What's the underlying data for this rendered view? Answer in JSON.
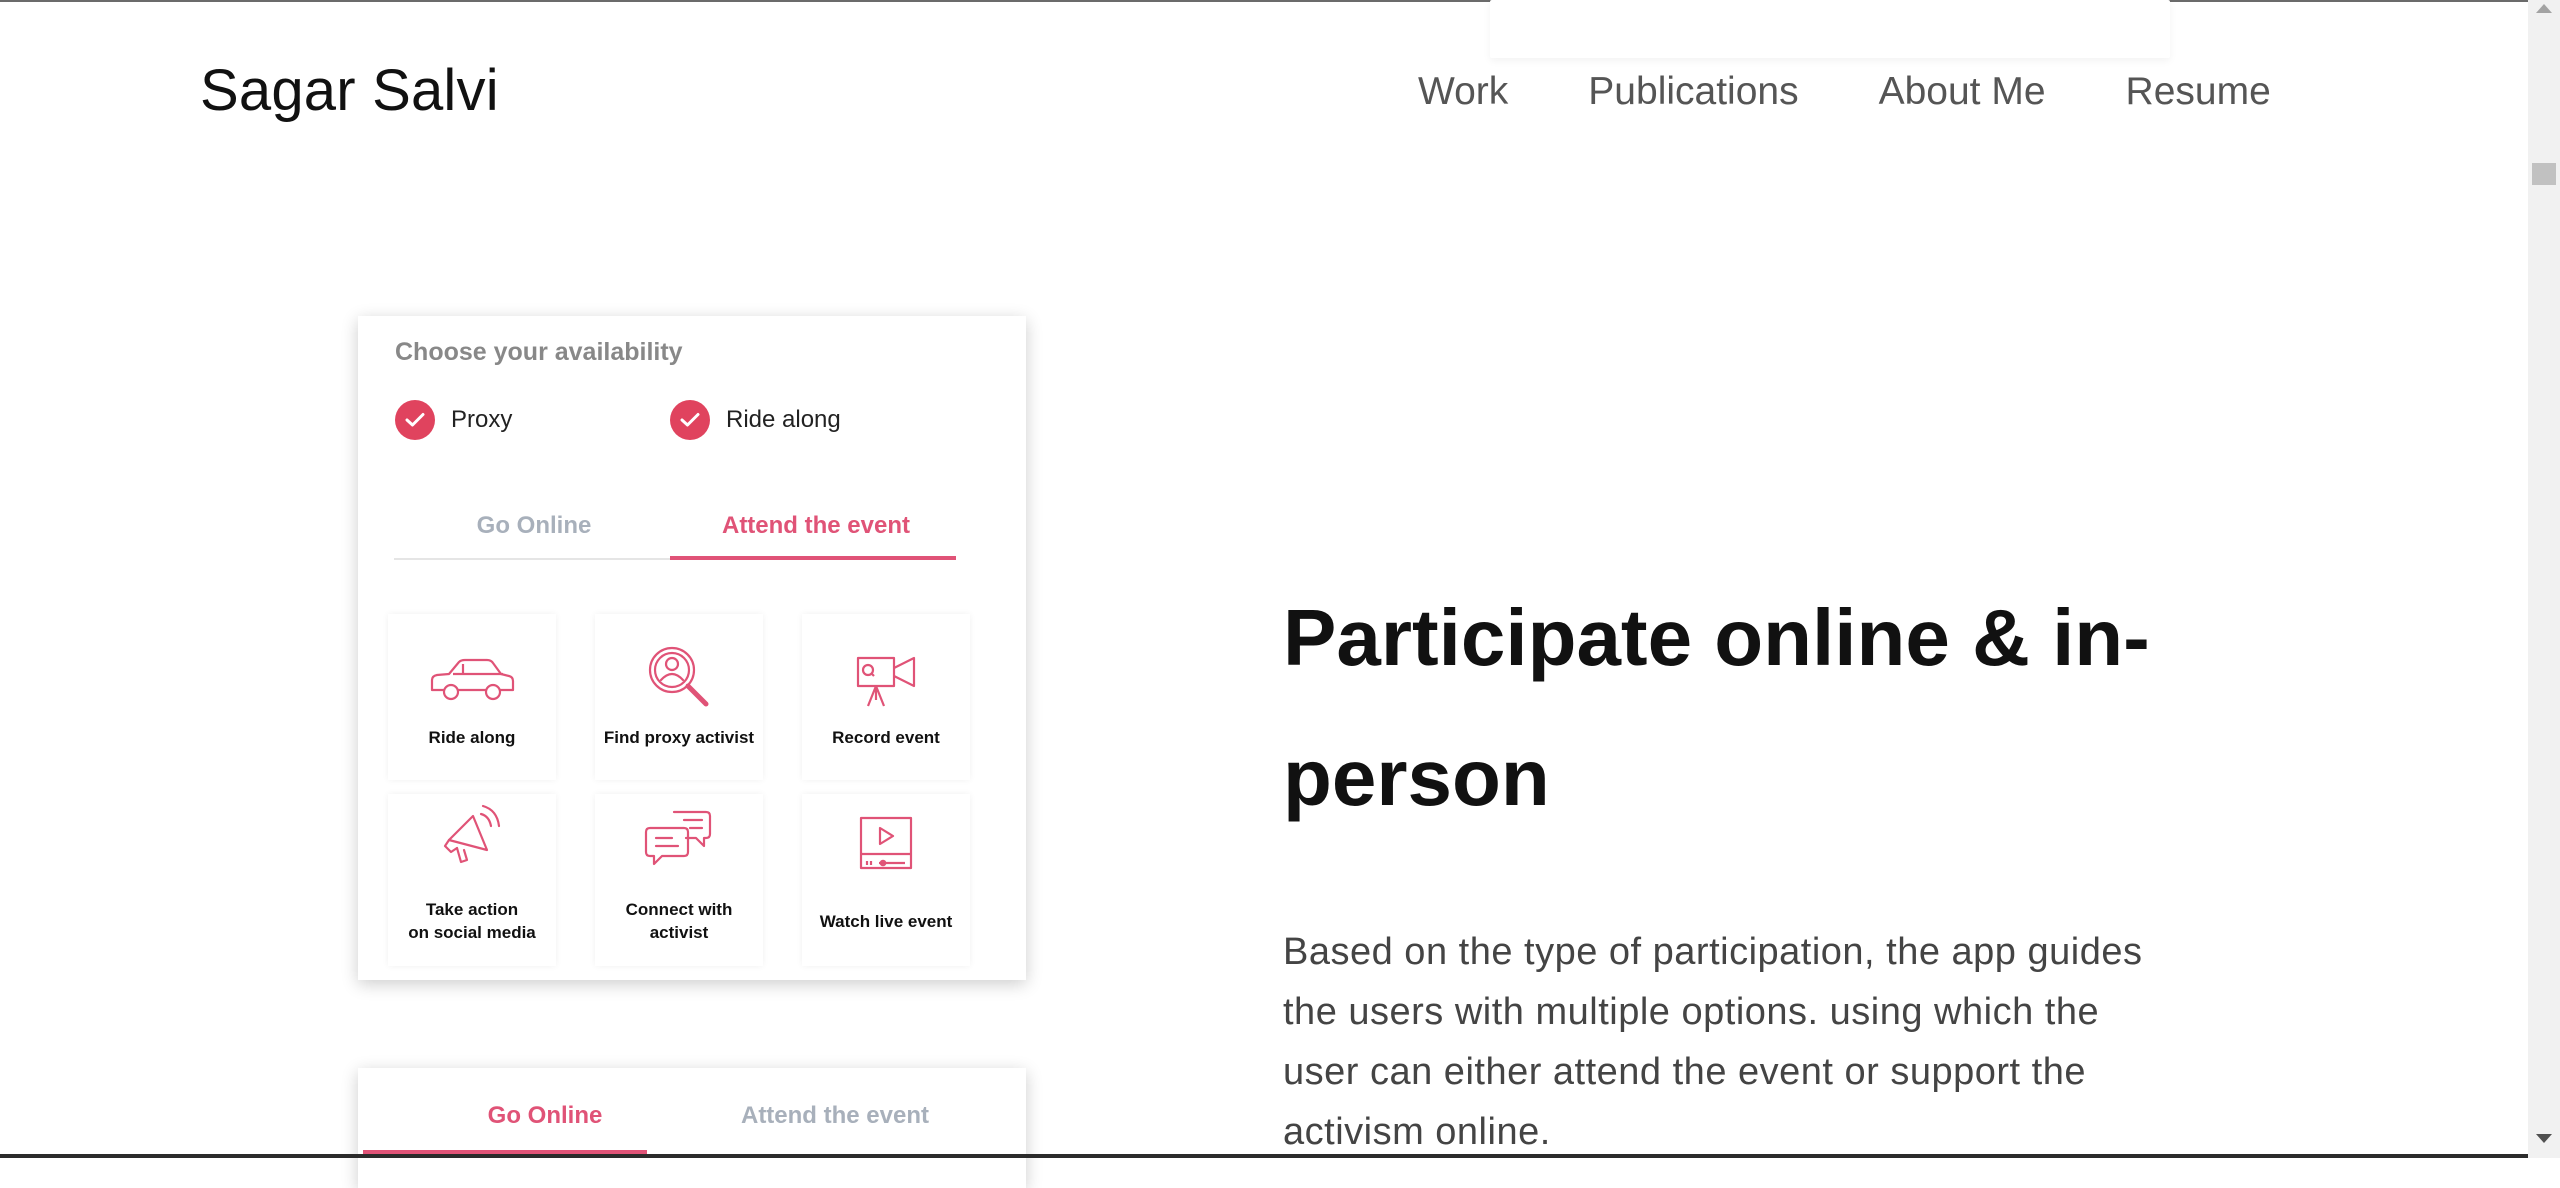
{
  "brand": "Sagar Salvi",
  "nav": [
    "Work",
    "Publications",
    "About Me",
    "Resume"
  ],
  "card1": {
    "heading": "Choose your availability",
    "checks": [
      "Proxy",
      "Ride along"
    ],
    "tabs": {
      "left": "Go Online",
      "right": "Attend the event",
      "active": "right"
    },
    "tiles": [
      {
        "label": "Ride along",
        "icon": "car-icon"
      },
      {
        "label": "Find proxy activist",
        "icon": "search-person-icon"
      },
      {
        "label": "Record event",
        "icon": "video-camera-icon"
      },
      {
        "label": "Take action\non social media",
        "icon": "megaphone-icon"
      },
      {
        "label": "Connect with\nactivist",
        "icon": "chat-bubbles-icon"
      },
      {
        "label": "Watch live event",
        "icon": "video-player-icon"
      }
    ]
  },
  "card2": {
    "tabs": {
      "left": "Go Online",
      "right": "Attend the event",
      "active": "left"
    }
  },
  "section": {
    "headline": "Participate online & in-person",
    "body": "Based on the type of participation, the app guides the users with multiple options. using which the user can either attend the event or support the activism online."
  },
  "colors": {
    "accent": "#e05377",
    "check": "#e0435e",
    "inactive_tab": "#a8b0bb"
  }
}
